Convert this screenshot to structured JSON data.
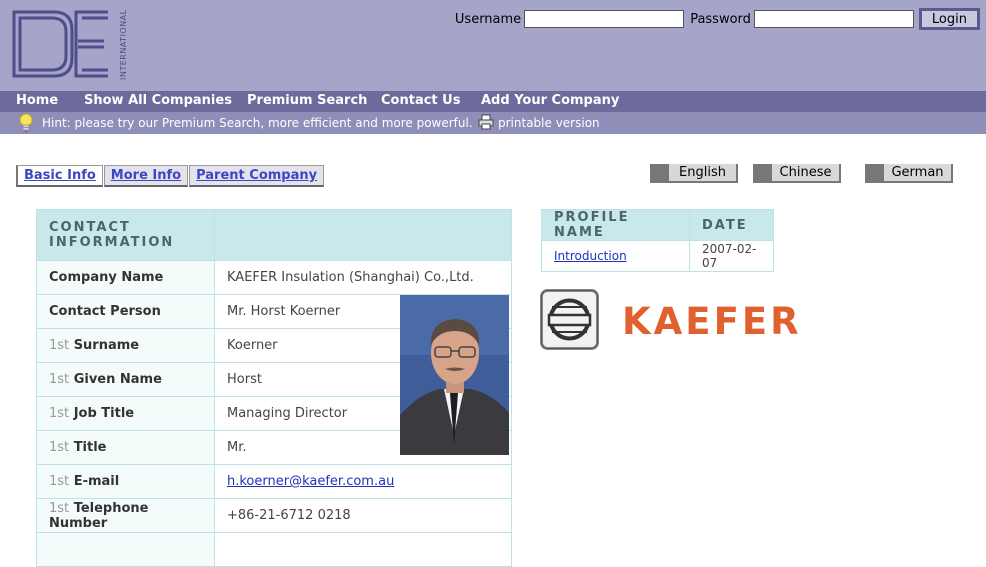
{
  "logo": {
    "side_text": "INTERNATIONAL"
  },
  "login": {
    "username_label": "Username",
    "password_label": "Password",
    "username_value": "",
    "password_value": "",
    "login_label": "Login"
  },
  "nav": [
    "Home",
    "Show All Companies",
    "Premium Search",
    "Contact Us",
    "Add Your Company"
  ],
  "hint": {
    "text": "Hint: please try our Premium Search, more efficient and more powerful.",
    "printable": "printable version"
  },
  "tabs": [
    "Basic Info",
    "More Info",
    "Parent Company"
  ],
  "languages": [
    "English",
    "Chinese",
    "German"
  ],
  "contact": {
    "header": "CONTACT INFORMATION",
    "rows": [
      {
        "prefix": "",
        "label": "Company Name",
        "value": "KAEFER Insulation (Shanghai) Co.,Ltd."
      },
      {
        "prefix": "",
        "label": "Contact Person",
        "value": "Mr. Horst Koerner"
      },
      {
        "prefix": "1st",
        "label": "Surname",
        "value": "Koerner"
      },
      {
        "prefix": "1st",
        "label": "Given Name",
        "value": "Horst"
      },
      {
        "prefix": "1st",
        "label": "Job Title",
        "value": "Managing Director"
      },
      {
        "prefix": "1st",
        "label": "Title",
        "value": "Mr."
      },
      {
        "prefix": "1st",
        "label": "E-mail",
        "value": "h.koerner@kaefer.com.au"
      },
      {
        "prefix": "1st",
        "label": "Telephone Number",
        "value": "+86-21-6712 0218"
      }
    ]
  },
  "profile": {
    "col_name": "PROFILE NAME",
    "col_date": "DATE",
    "rows": [
      {
        "name": "Introduction",
        "date": "2007-02-07"
      }
    ]
  },
  "brand": {
    "name": "KAEFER",
    "color": "#e0602e"
  },
  "colors": {
    "header_bg": "#a5a4c9",
    "nav_bg": "#6c6b9b",
    "hint_bg": "#8f8eb8",
    "table_head": "#c8e8e9"
  }
}
